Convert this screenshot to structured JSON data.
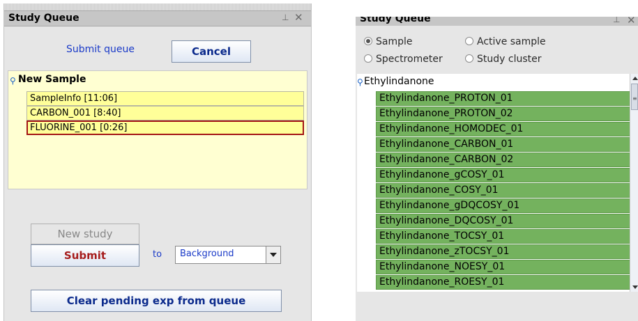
{
  "left_panel": {
    "title": "Study Queue",
    "pin_glyph": "ᵖ",
    "close_glyph": "╳",
    "submit_queue_label": "Submit queue",
    "cancel_label": "Cancel",
    "tree": {
      "root_label": "New Sample",
      "items": [
        "SampleInfo [11:06]",
        "CARBON_001 [8:40]",
        "FLUORINE_001 [0:26]"
      ],
      "selected_index": 2
    },
    "new_study_label": "New study",
    "submit_label": "Submit",
    "to_label": "to",
    "queue_select_value": "Background",
    "clear_label": "Clear pending exp from queue"
  },
  "right_panel": {
    "title": "Study Queue",
    "radios": [
      {
        "label": "Sample",
        "checked": true
      },
      {
        "label": "Active sample",
        "checked": false
      },
      {
        "label": "Spectrometer",
        "checked": false
      },
      {
        "label": "Study cluster",
        "checked": false
      }
    ],
    "tree": {
      "root_label": "Ethylindanone",
      "items": [
        "Ethylindanone_PROTON_01",
        "Ethylindanone_PROTON_02",
        "Ethylindanone_HOMODEC_01",
        "Ethylindanone_CARBON_01",
        "Ethylindanone_CARBON_02",
        "Ethylindanone_gCOSY_01",
        "Ethylindanone_COSY_01",
        "Ethylindanone_gDQCOSY_01",
        "Ethylindanone_DQCOSY_01",
        "Ethylindanone_TOCSY_01",
        "Ethylindanone_zTOCSY_01",
        "Ethylindanone_NOESY_01",
        "Ethylindanone_ROESY_01"
      ]
    }
  },
  "colors": {
    "queue_bg": "#ffffd2",
    "queue_item": "#ffff99",
    "selected_border": "#a31515",
    "completed_item": "#74b25e",
    "link_blue": "#1a3ac8"
  }
}
